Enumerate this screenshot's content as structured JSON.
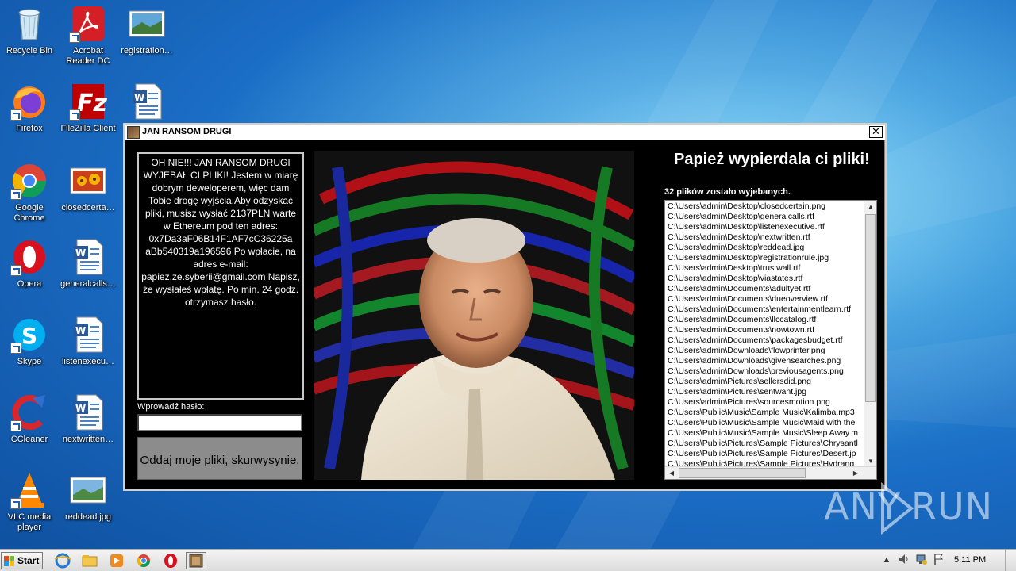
{
  "desktop": {
    "icons": [
      {
        "label": "Recycle Bin",
        "icon": "recycle-bin-icon"
      },
      {
        "label": "Acrobat Reader DC",
        "icon": "acrobat-reader-icon"
      },
      {
        "label": "registration…",
        "icon": "image-file-icon"
      },
      {
        "label": "Firefox",
        "icon": "firefox-icon"
      },
      {
        "label": "FileZilla Client",
        "icon": "filezilla-icon"
      },
      {
        "label": "",
        "icon": "word-document-icon"
      },
      {
        "label": "Google Chrome",
        "icon": "chrome-icon"
      },
      {
        "label": "closedcerta…",
        "icon": "image-file-icon"
      },
      {
        "label": "Opera",
        "icon": "opera-icon"
      },
      {
        "label": "generalcalls…",
        "icon": "word-document-icon"
      },
      {
        "label": "Skype",
        "icon": "skype-icon"
      },
      {
        "label": "listenexecu…",
        "icon": "word-document-icon"
      },
      {
        "label": "CCleaner",
        "icon": "ccleaner-icon"
      },
      {
        "label": "nextwritten…",
        "icon": "word-document-icon"
      },
      {
        "label": "VLC media player",
        "icon": "vlc-icon"
      },
      {
        "label": "reddead.jpg",
        "icon": "image-file-icon"
      }
    ]
  },
  "window": {
    "title": "JAN RANSOM DRUGI",
    "close_glyph": "✕",
    "message": "OH NIE!!! JAN RANSOM DRUGI WYJEBAŁ CI PLIKI! Jestem w miarę dobrym deweloperem, więc dam Tobie drogę wyjścia.Aby odzyskać pliki, musisz wysłać 2137PLN warte w Ethereum pod ten adres: 0x7Da3aF06B14F1AF7cC36225a aBb540319a196596 Po wpłacie, na adres e-mail: papiez.ze.syberii@gmail.com Napisz, że wysłałeś wpłatę. Po min. 24 godz. otrzymasz hasło.",
    "password_label": "Wprowadź hasło:",
    "password_value": "",
    "submit_label": "Oddaj moje pliki, skurwysynie.",
    "headline": "Papież wypierdala ci pliki!",
    "count_text": "32 plików zostało wyjebanych.",
    "files": [
      "C:\\Users\\admin\\Desktop\\closedcertain.png",
      "C:\\Users\\admin\\Desktop\\generalcalls.rtf",
      "C:\\Users\\admin\\Desktop\\listenexecutive.rtf",
      "C:\\Users\\admin\\Desktop\\nextwritten.rtf",
      "C:\\Users\\admin\\Desktop\\reddead.jpg",
      "C:\\Users\\admin\\Desktop\\registrationrule.jpg",
      "C:\\Users\\admin\\Desktop\\trustwall.rtf",
      "C:\\Users\\admin\\Desktop\\viastates.rtf",
      "C:\\Users\\admin\\Documents\\adultyet.rtf",
      "C:\\Users\\admin\\Documents\\dueoverview.rtf",
      "C:\\Users\\admin\\Documents\\entertainmentlearn.rtf",
      "C:\\Users\\admin\\Documents\\llccatalog.rtf",
      "C:\\Users\\admin\\Documents\\nowtown.rtf",
      "C:\\Users\\admin\\Documents\\packagesbudget.rtf",
      "C:\\Users\\admin\\Downloads\\flowprinter.png",
      "C:\\Users\\admin\\Downloads\\givensearches.png",
      "C:\\Users\\admin\\Downloads\\previousagents.png",
      "C:\\Users\\admin\\Pictures\\sellersdid.png",
      "C:\\Users\\admin\\Pictures\\sentwant.jpg",
      "C:\\Users\\admin\\Pictures\\sourcesmotion.png",
      "C:\\Users\\Public\\Music\\Sample Music\\Kalimba.mp3",
      "C:\\Users\\Public\\Music\\Sample Music\\Maid with the",
      "C:\\Users\\Public\\Music\\Sample Music\\Sleep Away.m",
      "C:\\Users\\Public\\Pictures\\Sample Pictures\\Chrysantl",
      "C:\\Users\\Public\\Pictures\\Sample Pictures\\Desert.jp",
      "C:\\Users\\Public\\Pictures\\Sample Pictures\\Hydrang"
    ]
  },
  "watermark": {
    "left": "ANY",
    "right": "RUN"
  },
  "taskbar": {
    "start_label": "Start",
    "clock": "5:11 PM",
    "pinned": [
      "ie-icon",
      "explorer-icon",
      "media-player-icon",
      "chrome-icon",
      "opera-icon",
      "ransom-app-icon"
    ],
    "tray": [
      "show-hidden-icon",
      "volume-icon",
      "network-icon",
      "action-center-flag-icon"
    ]
  },
  "colors": {
    "window_bg": "#000000",
    "button_bg": "#8c8c8c",
    "desktop": "#1a6cc4"
  }
}
